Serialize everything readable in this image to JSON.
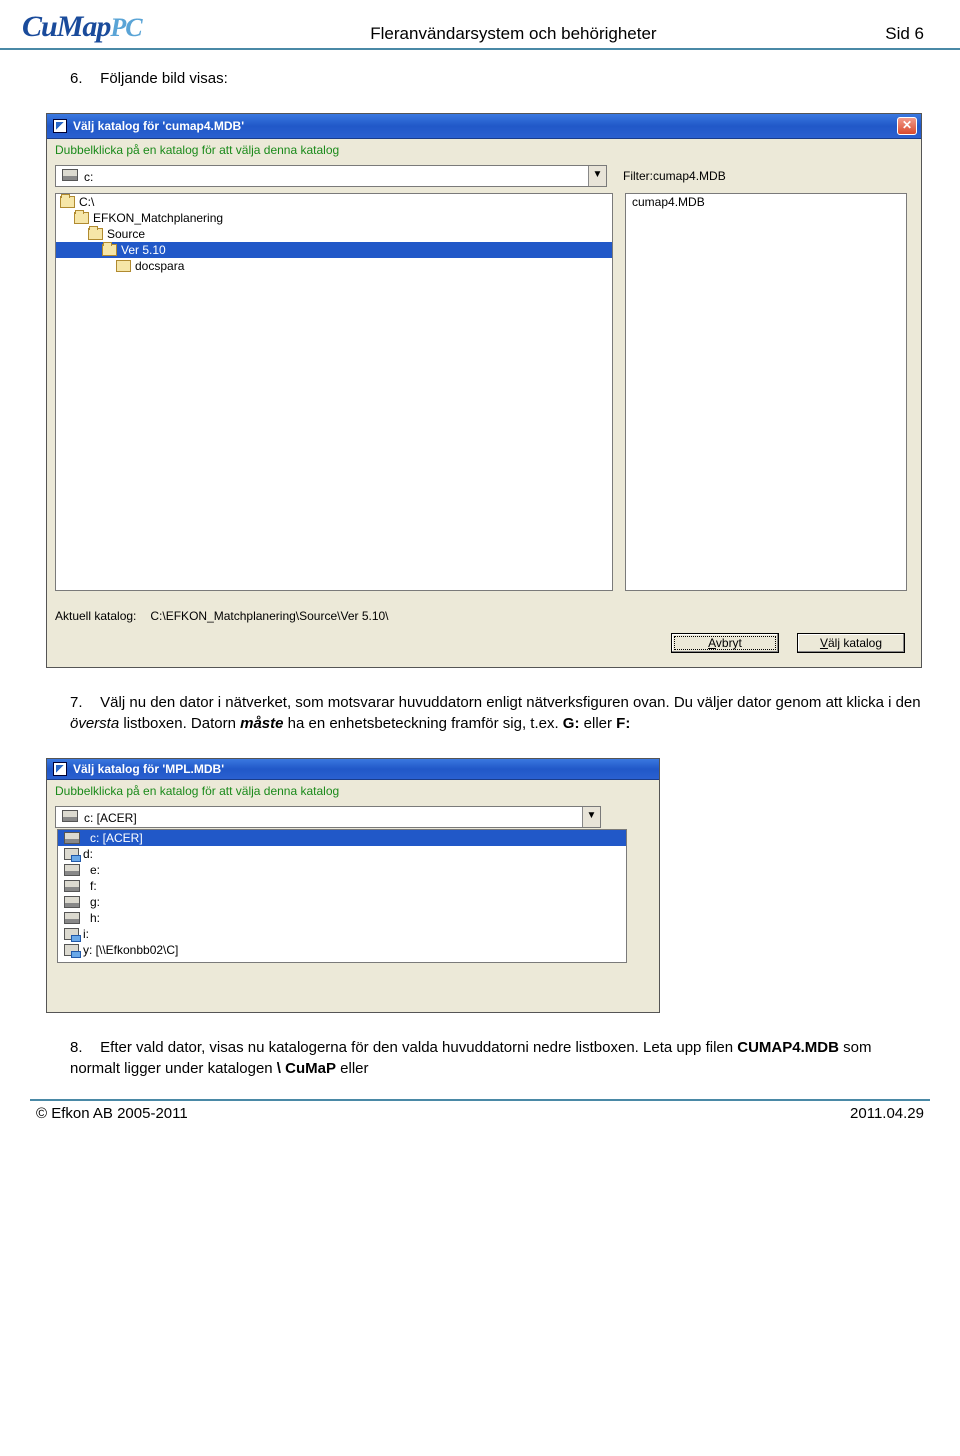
{
  "header": {
    "logo_main": "CuMap",
    "logo_suffix": "PC",
    "title": "Fleranvändarsystem och behörigheter",
    "page": "Sid 6"
  },
  "steps": {
    "s6": {
      "num": "6.",
      "text": "Följande bild visas:"
    },
    "s7": {
      "num": "7.",
      "p1a": "Välj nu den dator i nätverket, som motsvarar huvuddatorn enligt nätverksfiguren ovan. Du väljer dator genom att klicka i den ",
      "p1b_em": "översta",
      "p1c": " listboxen. Datorn ",
      "p1d_em": "måste",
      "p1e": " ha en enhetsbeteckning framför sig, t.ex. ",
      "p1f_b": "G:",
      "p1g": " eller ",
      "p1h_b": "F:"
    },
    "s8": {
      "num": "8.",
      "p1": "Efter vald dator, visas nu katalogerna för den valda huvuddatorni nedre listboxen. Leta upp filen ",
      "p2_b": "CUMAP4.MDB",
      "p3": " som normalt ligger under katalogen ",
      "p4_b": "\\ CuMaP",
      "p5": " eller"
    }
  },
  "dlg1": {
    "title": "Välj katalog för 'cumap4.MDB'",
    "instr": "Dubbelklicka på en katalog för att välja denna katalog",
    "drive": "c:",
    "filter_label": "Filter:cumap4.MDB",
    "folders": {
      "f0": "C:\\",
      "f1": "EFKON_Matchplanering",
      "f2": "Source",
      "f3": "Ver 5.10",
      "f4": "docspara"
    },
    "file0": "cumap4.MDB",
    "aktuell_label": "Aktuell katalog:",
    "aktuell_path": "C:\\EFKON_Matchplanering\\Source\\Ver 5.10\\",
    "btn_cancel_pre": "A",
    "btn_cancel_post": "vbryt",
    "btn_ok_pre": "V",
    "btn_ok_post": "älj katalog"
  },
  "dlg2": {
    "title": "Välj katalog för 'MPL.MDB'",
    "instr": "Dubbelklicka på en katalog för att välja denna katalog",
    "drive": "c: [ACER]",
    "drives": {
      "d0": "c: [ACER]",
      "d1": "d:",
      "d2": "e:",
      "d3": "f:",
      "d4": "g:",
      "d5": "h:",
      "d6": "i:",
      "d7": "y: [\\\\Efkonbb02\\C]"
    }
  },
  "footer": {
    "left": "© Efkon AB 2005-2011",
    "right": "2011.04.29"
  }
}
